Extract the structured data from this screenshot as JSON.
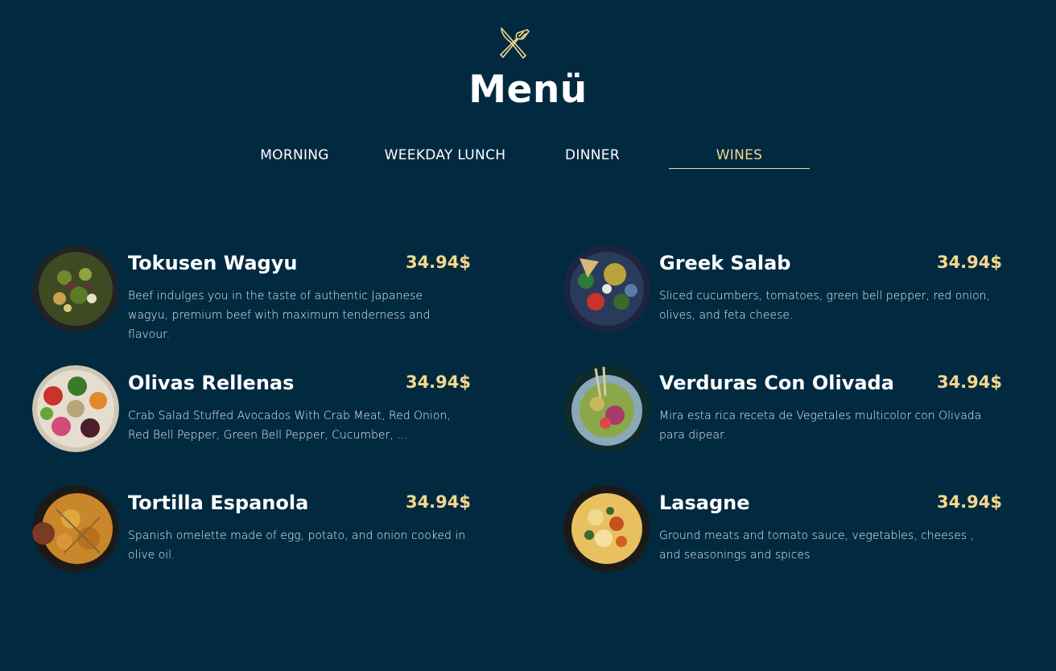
{
  "header": {
    "logo_icon": "fork-knife-icon",
    "title": "Menü"
  },
  "tabs": [
    {
      "label": "MORNING",
      "active": false
    },
    {
      "label": "WEEKDAY LUNCH",
      "active": false
    },
    {
      "label": "DINNER",
      "active": false
    },
    {
      "label": "WINES",
      "active": true
    }
  ],
  "items": [
    {
      "name": "Tokusen Wagyu",
      "price": "34.94$",
      "description": "Beef indulges you in the taste of authentic Japanese wagyu, premium beef with maximum tenderness and flavour."
    },
    {
      "name": "Olivas Rellenas",
      "price": "34.94$",
      "description": "Crab Salad Stuffed Avocados With Crab Meat, Red Onion, Red Bell Pepper, Green Bell Pepper, Cucumber, ..."
    },
    {
      "name": "Tortilla Espanola",
      "price": "34.94$",
      "description": "Spanish omelette made of egg, potato, and onion cooked in olive oil."
    },
    {
      "name": "Greek Salab",
      "price": "34.94$",
      "description": "Sliced cucumbers, tomatoes, green bell pepper, red onion, olives, and feta cheese."
    },
    {
      "name": "Verduras Con Olivada",
      "price": "34.94$",
      "description": "Mira esta rica receta de Vegetales multicolor con Olivada para dipear."
    },
    {
      "name": "Lasagne",
      "price": "34.94$",
      "description": "Ground meats and tomato sauce, vegetables, cheeses , and seasonings and spices"
    }
  ],
  "colors": {
    "background": "#012a41",
    "accent": "#f5d88c",
    "text": "#ffffff"
  }
}
